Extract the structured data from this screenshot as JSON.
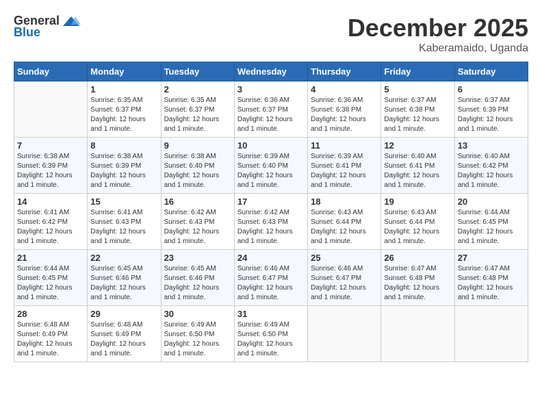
{
  "header": {
    "logo_general": "General",
    "logo_blue": "Blue",
    "month_year": "December 2025",
    "location": "Kaberamaido, Uganda"
  },
  "weekdays": [
    "Sunday",
    "Monday",
    "Tuesday",
    "Wednesday",
    "Thursday",
    "Friday",
    "Saturday"
  ],
  "weeks": [
    [
      {
        "day": "",
        "sunrise": "",
        "sunset": "",
        "daylight": ""
      },
      {
        "day": "1",
        "sunrise": "Sunrise: 6:35 AM",
        "sunset": "Sunset: 6:37 PM",
        "daylight": "Daylight: 12 hours and 1 minute."
      },
      {
        "day": "2",
        "sunrise": "Sunrise: 6:35 AM",
        "sunset": "Sunset: 6:37 PM",
        "daylight": "Daylight: 12 hours and 1 minute."
      },
      {
        "day": "3",
        "sunrise": "Sunrise: 6:36 AM",
        "sunset": "Sunset: 6:37 PM",
        "daylight": "Daylight: 12 hours and 1 minute."
      },
      {
        "day": "4",
        "sunrise": "Sunrise: 6:36 AM",
        "sunset": "Sunset: 6:38 PM",
        "daylight": "Daylight: 12 hours and 1 minute."
      },
      {
        "day": "5",
        "sunrise": "Sunrise: 6:37 AM",
        "sunset": "Sunset: 6:38 PM",
        "daylight": "Daylight: 12 hours and 1 minute."
      },
      {
        "day": "6",
        "sunrise": "Sunrise: 6:37 AM",
        "sunset": "Sunset: 6:39 PM",
        "daylight": "Daylight: 12 hours and 1 minute."
      }
    ],
    [
      {
        "day": "7",
        "sunrise": "Sunrise: 6:38 AM",
        "sunset": "Sunset: 6:39 PM",
        "daylight": "Daylight: 12 hours and 1 minute."
      },
      {
        "day": "8",
        "sunrise": "Sunrise: 6:38 AM",
        "sunset": "Sunset: 6:39 PM",
        "daylight": "Daylight: 12 hours and 1 minute."
      },
      {
        "day": "9",
        "sunrise": "Sunrise: 6:38 AM",
        "sunset": "Sunset: 6:40 PM",
        "daylight": "Daylight: 12 hours and 1 minute."
      },
      {
        "day": "10",
        "sunrise": "Sunrise: 6:39 AM",
        "sunset": "Sunset: 6:40 PM",
        "daylight": "Daylight: 12 hours and 1 minute."
      },
      {
        "day": "11",
        "sunrise": "Sunrise: 6:39 AM",
        "sunset": "Sunset: 6:41 PM",
        "daylight": "Daylight: 12 hours and 1 minute."
      },
      {
        "day": "12",
        "sunrise": "Sunrise: 6:40 AM",
        "sunset": "Sunset: 6:41 PM",
        "daylight": "Daylight: 12 hours and 1 minute."
      },
      {
        "day": "13",
        "sunrise": "Sunrise: 6:40 AM",
        "sunset": "Sunset: 6:42 PM",
        "daylight": "Daylight: 12 hours and 1 minute."
      }
    ],
    [
      {
        "day": "14",
        "sunrise": "Sunrise: 6:41 AM",
        "sunset": "Sunset: 6:42 PM",
        "daylight": "Daylight: 12 hours and 1 minute."
      },
      {
        "day": "15",
        "sunrise": "Sunrise: 6:41 AM",
        "sunset": "Sunset: 6:43 PM",
        "daylight": "Daylight: 12 hours and 1 minute."
      },
      {
        "day": "16",
        "sunrise": "Sunrise: 6:42 AM",
        "sunset": "Sunset: 6:43 PM",
        "daylight": "Daylight: 12 hours and 1 minute."
      },
      {
        "day": "17",
        "sunrise": "Sunrise: 6:42 AM",
        "sunset": "Sunset: 6:43 PM",
        "daylight": "Daylight: 12 hours and 1 minute."
      },
      {
        "day": "18",
        "sunrise": "Sunrise: 6:43 AM",
        "sunset": "Sunset: 6:44 PM",
        "daylight": "Daylight: 12 hours and 1 minute."
      },
      {
        "day": "19",
        "sunrise": "Sunrise: 6:43 AM",
        "sunset": "Sunset: 6:44 PM",
        "daylight": "Daylight: 12 hours and 1 minute."
      },
      {
        "day": "20",
        "sunrise": "Sunrise: 6:44 AM",
        "sunset": "Sunset: 6:45 PM",
        "daylight": "Daylight: 12 hours and 1 minute."
      }
    ],
    [
      {
        "day": "21",
        "sunrise": "Sunrise: 6:44 AM",
        "sunset": "Sunset: 6:45 PM",
        "daylight": "Daylight: 12 hours and 1 minute."
      },
      {
        "day": "22",
        "sunrise": "Sunrise: 6:45 AM",
        "sunset": "Sunset: 6:46 PM",
        "daylight": "Daylight: 12 hours and 1 minute."
      },
      {
        "day": "23",
        "sunrise": "Sunrise: 6:45 AM",
        "sunset": "Sunset: 6:46 PM",
        "daylight": "Daylight: 12 hours and 1 minute."
      },
      {
        "day": "24",
        "sunrise": "Sunrise: 6:46 AM",
        "sunset": "Sunset: 6:47 PM",
        "daylight": "Daylight: 12 hours and 1 minute."
      },
      {
        "day": "25",
        "sunrise": "Sunrise: 6:46 AM",
        "sunset": "Sunset: 6:47 PM",
        "daylight": "Daylight: 12 hours and 1 minute."
      },
      {
        "day": "26",
        "sunrise": "Sunrise: 6:47 AM",
        "sunset": "Sunset: 6:48 PM",
        "daylight": "Daylight: 12 hours and 1 minute."
      },
      {
        "day": "27",
        "sunrise": "Sunrise: 6:47 AM",
        "sunset": "Sunset: 6:48 PM",
        "daylight": "Daylight: 12 hours and 1 minute."
      }
    ],
    [
      {
        "day": "28",
        "sunrise": "Sunrise: 6:48 AM",
        "sunset": "Sunset: 6:49 PM",
        "daylight": "Daylight: 12 hours and 1 minute."
      },
      {
        "day": "29",
        "sunrise": "Sunrise: 6:48 AM",
        "sunset": "Sunset: 6:49 PM",
        "daylight": "Daylight: 12 hours and 1 minute."
      },
      {
        "day": "30",
        "sunrise": "Sunrise: 6:49 AM",
        "sunset": "Sunset: 6:50 PM",
        "daylight": "Daylight: 12 hours and 1 minute."
      },
      {
        "day": "31",
        "sunrise": "Sunrise: 6:49 AM",
        "sunset": "Sunset: 6:50 PM",
        "daylight": "Daylight: 12 hours and 1 minute."
      },
      {
        "day": "",
        "sunrise": "",
        "sunset": "",
        "daylight": ""
      },
      {
        "day": "",
        "sunrise": "",
        "sunset": "",
        "daylight": ""
      },
      {
        "day": "",
        "sunrise": "",
        "sunset": "",
        "daylight": ""
      }
    ]
  ]
}
